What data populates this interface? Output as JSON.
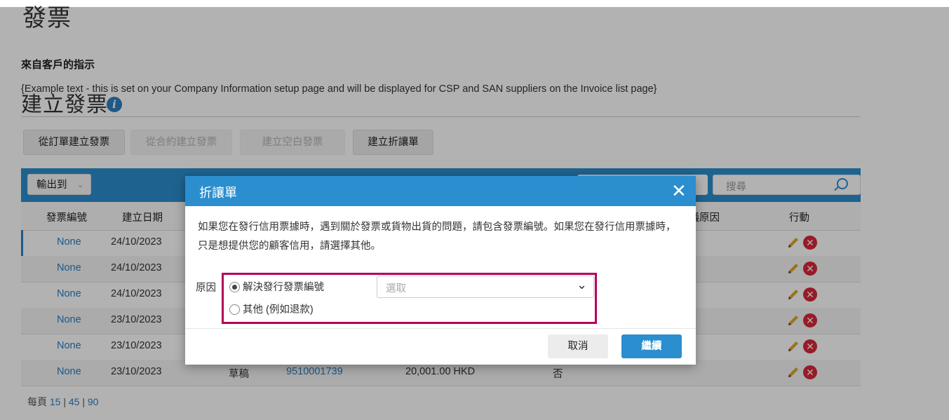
{
  "page": {
    "title": "發票",
    "instructions_title": "來自客戶的指示",
    "instructions_text": "{Example text - this is set on your Company Information setup page and will be displayed for CSP and SAN suppliers on the Invoice list page}",
    "section_title": "建立發票"
  },
  "toolbar": {
    "create_from_order": "從訂單建立發票",
    "create_from_contract": "從合約建立發票",
    "create_blank": "建立空白發票",
    "create_credit_note": "建立折讓單"
  },
  "table": {
    "export_label": "輸出到",
    "search_placeholder": "搜尋",
    "headers": {
      "invoice_no": "發票編號",
      "created_date": "建立日期",
      "dispute_reason": "爭議原因",
      "actions": "行動"
    },
    "rows": [
      {
        "invoice_no": "None",
        "created_date": "24/10/2023"
      },
      {
        "invoice_no": "None",
        "created_date": "24/10/2023"
      },
      {
        "invoice_no": "None",
        "created_date": "24/10/2023"
      },
      {
        "invoice_no": "None",
        "created_date": "23/10/2023"
      },
      {
        "invoice_no": "None",
        "created_date": "23/10/2023"
      },
      {
        "invoice_no": "None",
        "created_date": "23/10/2023",
        "status": "草稿",
        "number": "9510001739",
        "amount": "20,001.00 HKD",
        "flag": "否"
      }
    ]
  },
  "pager": {
    "label": "每頁",
    "option1": "15",
    "sep1": "|",
    "option2": "45",
    "sep2": "|",
    "option3": "90"
  },
  "modal": {
    "title": "折讓單",
    "close": "✕",
    "body": "如果您在發行信用票據時，遇到關於發票或貨物出貨的問題，請包含發票編號。如果您在發行信用票據時，只是想提供您的顧客信用，請選擇其他。",
    "reason_label": "原因",
    "option_resolve": "解決發行發票編號",
    "option_other": "其他 (例如退款)",
    "select_placeholder": "選取",
    "cancel": "取消",
    "continue": "繼續"
  },
  "colors": {
    "primary": "#2b8ecf",
    "link": "#2b7ec2",
    "highlight": "#b5005b",
    "delete": "#d9283a",
    "edit": "#e0a52c"
  },
  "icons": {
    "info": "info-icon",
    "search": "search-icon",
    "edit": "pencil-icon",
    "delete": "delete-circle-icon",
    "close": "close-icon",
    "chevron": "chevron-down-icon"
  }
}
